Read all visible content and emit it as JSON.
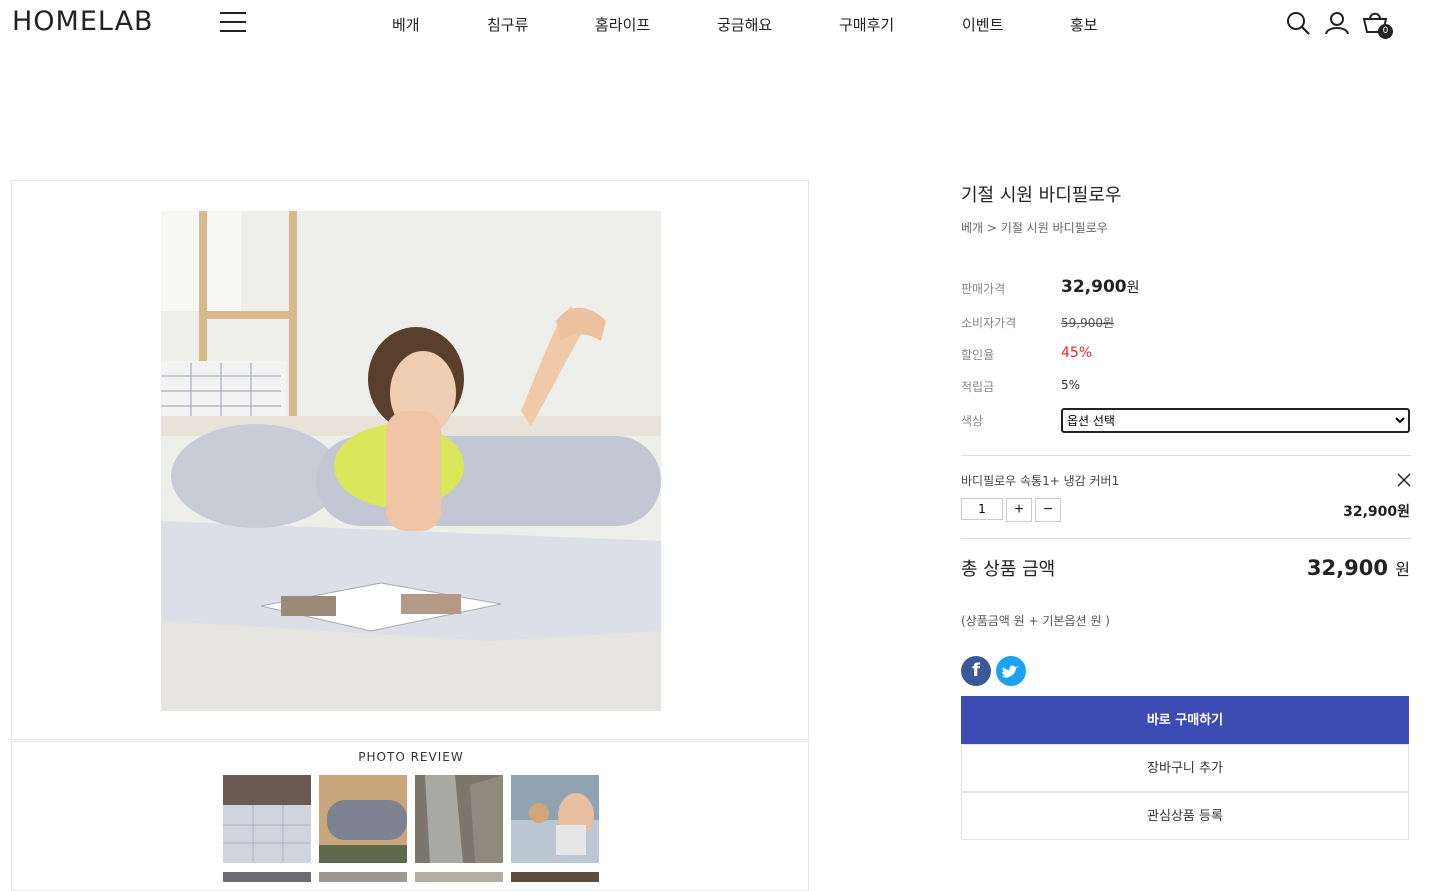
{
  "header": {
    "logo": "HOMELAB",
    "nav": [
      "베개",
      "침구류",
      "홈라이프",
      "궁금해요",
      "구매후기",
      "이벤트",
      "홍보"
    ],
    "cart_count": "0",
    "icons": [
      "search-icon",
      "user-icon",
      "cart-icon",
      "menu-icon"
    ]
  },
  "gallery": {
    "review_title": "PHOTO REVIEW",
    "thumb_count": 4
  },
  "product": {
    "title": "기절 시원 바디필로우",
    "breadcrumb_category": "베개",
    "breadcrumb_sep": " > ",
    "breadcrumb_item": "기절 시원 바디필로우",
    "rows": {
      "sale_label": "판매가격",
      "sale_value": "32,900",
      "sale_unit": "원",
      "consumer_label": "소비자가격",
      "consumer_value": "59,900원",
      "discount_label": "할인율",
      "discount_value": "45%",
      "points_label": "적립금",
      "points_value": "5%",
      "color_label": "색상",
      "color_option": "옵션 선택"
    },
    "selected": {
      "name": "바디필로우 속통1+ 냉감 커버1",
      "qty": "1",
      "plus": "+",
      "minus": "−",
      "price": "32,900원"
    },
    "total": {
      "label": "총 상품 금액",
      "value": "32,900",
      "unit": "원",
      "note": "(상품금액 원 + 기본옵션 원 )"
    },
    "buttons": {
      "buy": "바로 구매하기",
      "cart": "장바구니 추가",
      "wish": "관심상품 등록"
    }
  },
  "colors": {
    "primary": "#3d4bb5",
    "discount": "#e8242c",
    "facebook": "#3b5998",
    "twitter": "#1da1f2"
  }
}
